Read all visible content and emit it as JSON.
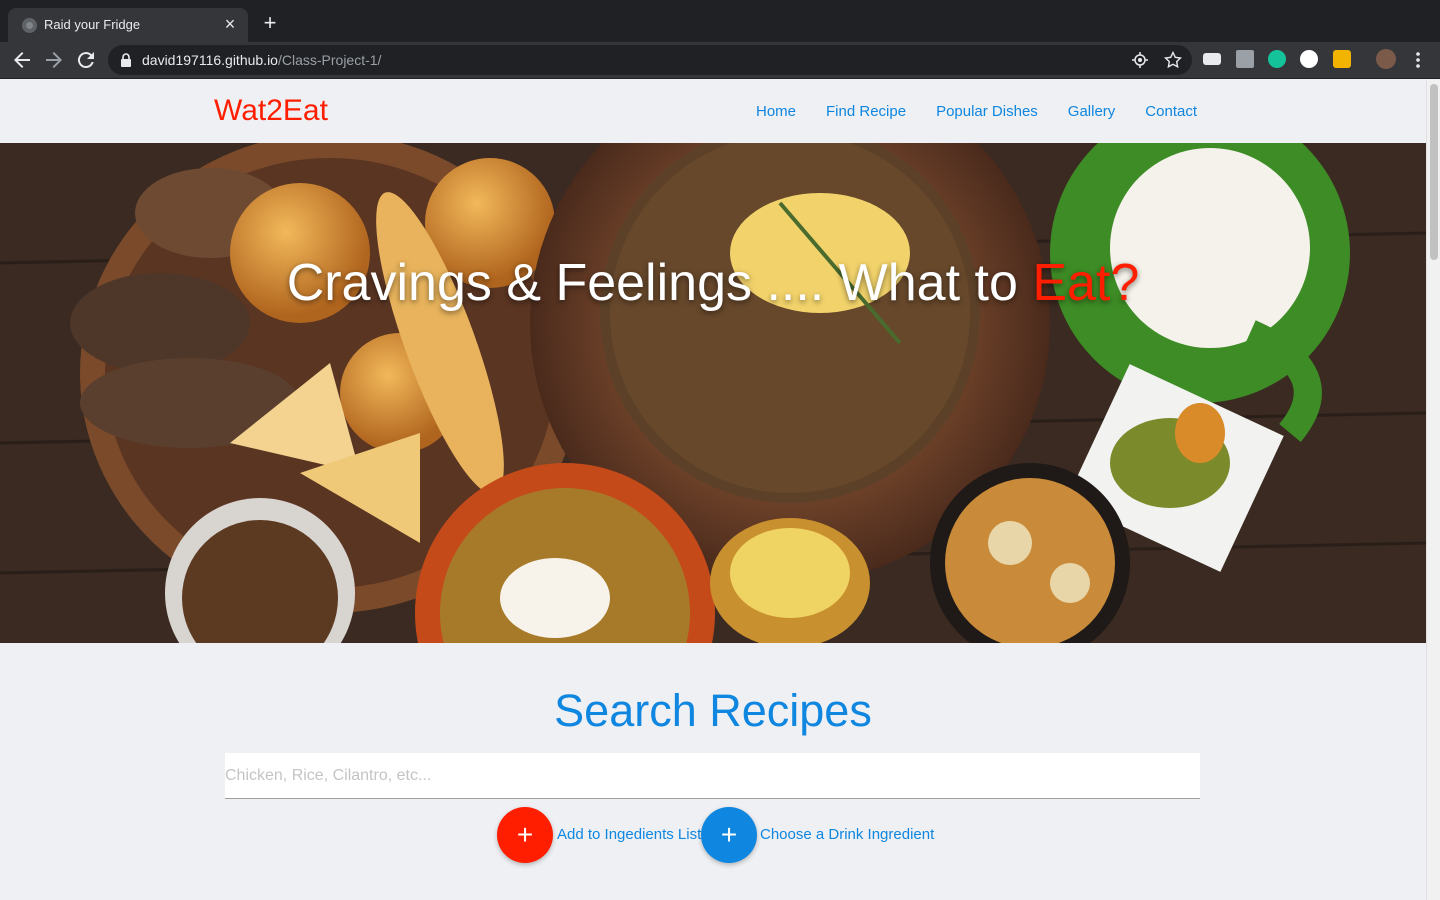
{
  "browser": {
    "tab_title": "Raid your Fridge",
    "tab_close": "×",
    "new_tab": "+",
    "url_host": "david197116.github.io",
    "url_path": "/Class-Project-1/"
  },
  "site": {
    "brand": "Wat2Eat",
    "nav": [
      "Home",
      "Find Recipe",
      "Popular Dishes",
      "Gallery",
      "Contact"
    ]
  },
  "hero": {
    "title_main": "Cravings & Feelings .... What to ",
    "title_accent": "Eat?"
  },
  "search": {
    "title": "Search Recipes",
    "placeholder": "Chicken, Rice, Cilantro, etc...",
    "add_button_symbol": "+",
    "add_label": "Add to Ingedients List",
    "drink_button_symbol": "+",
    "drink_label": "Choose a Drink Ingredient"
  },
  "colors": {
    "brand_red": "#ff1e00",
    "link_blue": "#0f86e0",
    "page_bg": "#eef0f3"
  }
}
